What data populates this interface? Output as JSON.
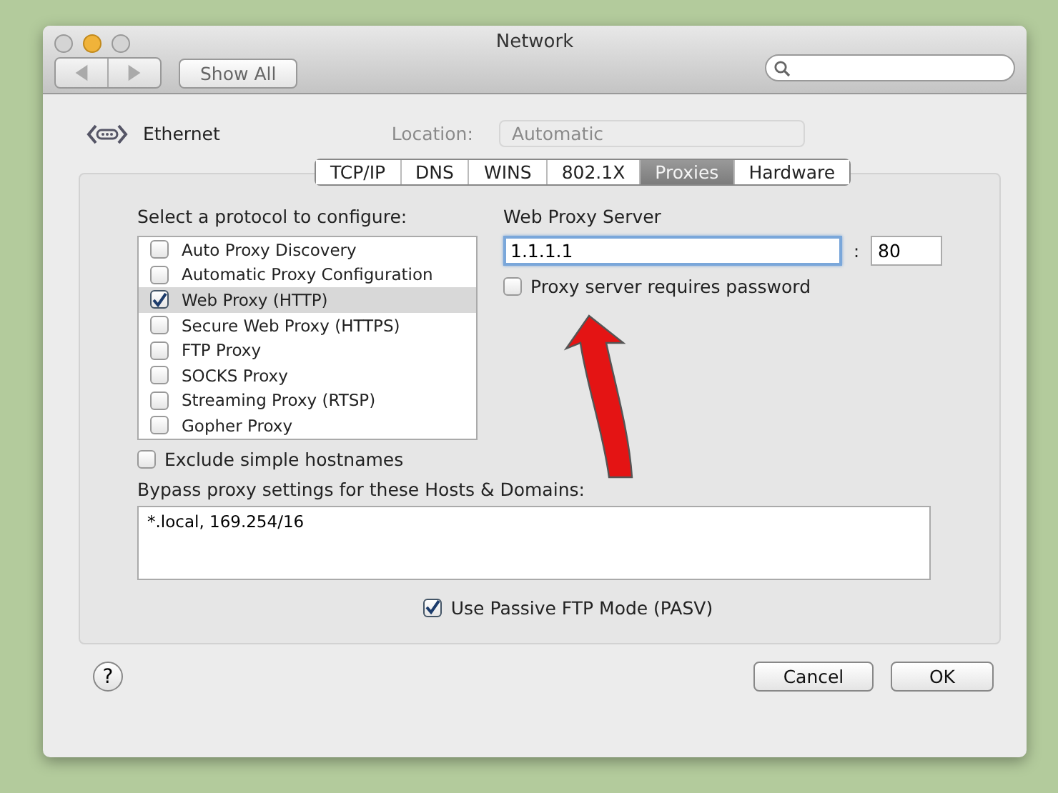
{
  "window": {
    "title": "Network"
  },
  "toolbar": {
    "show_all": "Show All"
  },
  "header": {
    "interface": "Ethernet",
    "location_label": "Location:",
    "location_value": "Automatic"
  },
  "tabs": [
    {
      "label": "TCP/IP",
      "selected": false
    },
    {
      "label": "DNS",
      "selected": false
    },
    {
      "label": "WINS",
      "selected": false
    },
    {
      "label": "802.1X",
      "selected": false
    },
    {
      "label": "Proxies",
      "selected": true
    },
    {
      "label": "Hardware",
      "selected": false
    }
  ],
  "protocols": {
    "label": "Select a protocol to configure:",
    "items": [
      {
        "label": "Auto Proxy Discovery",
        "checked": false,
        "selected": false
      },
      {
        "label": "Automatic Proxy Configuration",
        "checked": false,
        "selected": false
      },
      {
        "label": "Web Proxy (HTTP)",
        "checked": true,
        "selected": true
      },
      {
        "label": "Secure Web Proxy (HTTPS)",
        "checked": false,
        "selected": false
      },
      {
        "label": "FTP Proxy",
        "checked": false,
        "selected": false
      },
      {
        "label": "SOCKS Proxy",
        "checked": false,
        "selected": false
      },
      {
        "label": "Streaming Proxy (RTSP)",
        "checked": false,
        "selected": false
      },
      {
        "label": "Gopher Proxy",
        "checked": false,
        "selected": false
      }
    ]
  },
  "exclude_simple_hostnames": {
    "label": "Exclude simple hostnames",
    "checked": false
  },
  "server": {
    "label": "Web Proxy Server",
    "host": "1.1.1.1",
    "separator": ":",
    "port": "80",
    "requires_password": {
      "label": "Proxy server requires password",
      "checked": false
    }
  },
  "bypass": {
    "label": "Bypass proxy settings for these Hosts & Domains:",
    "value": "*.local, 169.254/16"
  },
  "passive_ftp": {
    "label": "Use Passive FTP Mode (PASV)",
    "checked": true
  },
  "help": "?",
  "buttons": [
    {
      "label": "Cancel",
      "kind": "normal"
    },
    {
      "label": "OK",
      "kind": "default"
    }
  ]
}
